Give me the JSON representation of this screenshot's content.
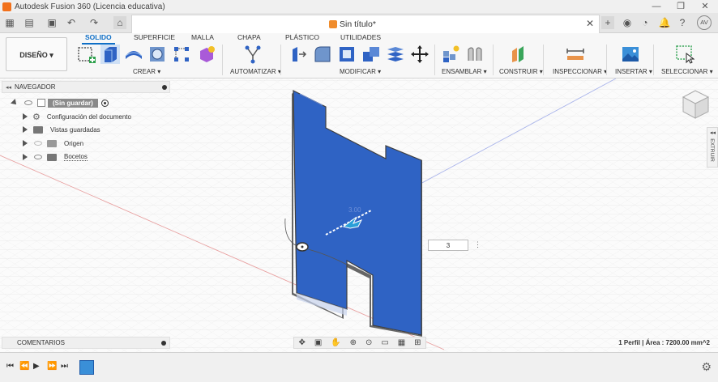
{
  "window": {
    "title": "Autodesk Fusion 360 (Licencia educativa)",
    "controls": [
      "—",
      "❐",
      "✕"
    ]
  },
  "document": {
    "title": "Sin título*"
  },
  "user": {
    "initials": "AV"
  },
  "ribbon": {
    "workspace_label": "DISEÑO ▾",
    "tabs": [
      {
        "label": "SOLIDO",
        "active": true
      },
      {
        "label": "SUPERFICIE",
        "active": false
      },
      {
        "label": "MALLA",
        "active": false
      },
      {
        "label": "CHAPA",
        "active": false
      },
      {
        "label": "PLÁSTICO",
        "active": false
      },
      {
        "label": "UTILIDADES",
        "active": false
      }
    ],
    "groups": {
      "crear": "CREAR ▾",
      "automatizar": "AUTOMATIZAR ▾",
      "modificar": "MODIFICAR ▾",
      "ensamblar": "ENSAMBLAR ▾",
      "construir": "CONSTRUIR ▾",
      "inspeccionar": "INSPECCIONAR ▾",
      "insertar": "INSERTAR ▾",
      "seleccionar": "SELECCIONAR ▾"
    },
    "accent": "#0f6fc6"
  },
  "browser": {
    "header": "NAVEGADOR",
    "root": "(Sin guardar)",
    "items": [
      {
        "label": "Configuración del documento"
      },
      {
        "label": "Vistas guardadas"
      },
      {
        "label": "Origen"
      },
      {
        "label": "Bocetos"
      }
    ]
  },
  "comments": {
    "label": "COMENTARIOS"
  },
  "extrude_panel": {
    "label": "EXTRUIR"
  },
  "viewport": {
    "dimension_input": "3",
    "dim_label": "3.00",
    "body_color": "#2f63c4"
  },
  "status": {
    "selection": "1 Perfil | Área : 7200.00 mm^2"
  }
}
